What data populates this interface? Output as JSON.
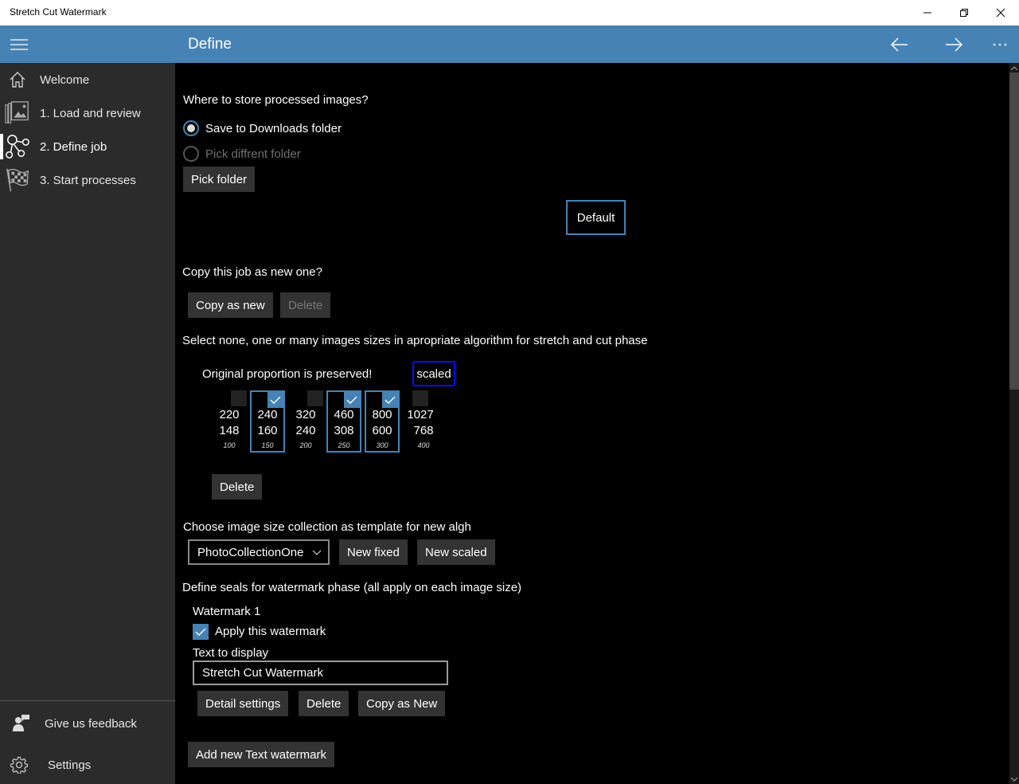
{
  "window": {
    "title": "Stretch Cut Watermark",
    "controls": [
      "minimize",
      "restore",
      "close"
    ]
  },
  "header": {
    "title": "Define",
    "back_icon": "arrow-left-icon",
    "forward_icon": "arrow-right-icon",
    "more_icon": "more-icon",
    "accent_color": "#4682b4"
  },
  "sidebar": {
    "items": [
      {
        "label": "Welcome",
        "icon": "home-icon"
      },
      {
        "label": "1. Load and review",
        "icon": "photos-icon"
      },
      {
        "label": "2. Define job",
        "icon": "nodes-icon",
        "active": true
      },
      {
        "label": "3. Start processes",
        "icon": "checkered-flag-icon"
      }
    ],
    "footer": [
      {
        "label": "Give us feedback",
        "icon": "feedback-icon"
      },
      {
        "label": "Settings",
        "icon": "gear-icon"
      }
    ]
  },
  "storage": {
    "question": "Where to store processed images?",
    "options": [
      {
        "label": "Save to Downloads folder",
        "selected": true,
        "enabled": true
      },
      {
        "label": "Pick diffrent folder",
        "selected": false,
        "enabled": false
      }
    ],
    "pick_folder_label": "Pick folder",
    "default_label": "Default"
  },
  "copy_job": {
    "question": "Copy this job as new one?",
    "copy_label": "Copy as new",
    "delete_label": "Delete"
  },
  "sizes": {
    "instruction": "Select none, one or many images sizes in apropriate algorithm for stretch and cut phase",
    "note": "Original proportion is preserved!",
    "mode_label": "scaled",
    "items": [
      {
        "width": "220",
        "height": "148",
        "num": "100",
        "checked": false
      },
      {
        "width": "240",
        "height": "160",
        "num": "150",
        "checked": true
      },
      {
        "width": "320",
        "height": "240",
        "num": "200",
        "checked": false
      },
      {
        "width": "460",
        "height": "308",
        "num": "250",
        "checked": true
      },
      {
        "width": "800",
        "height": "600",
        "num": "300",
        "checked": true
      },
      {
        "width": "1027",
        "height": "768",
        "num": "400",
        "checked": false
      }
    ],
    "delete_label": "Delete"
  },
  "template": {
    "label": "Choose image size collection as template for new algh",
    "selected_collection": "PhotoCollectionOne",
    "new_fixed_label": "New fixed",
    "new_scaled_label": "New scaled"
  },
  "watermarks": {
    "label": "Define seals for watermark phase (all apply on each image size)",
    "items": [
      {
        "title": "Watermark 1",
        "apply_label": "Apply this watermark",
        "apply_checked": true,
        "text_label": "Text to display",
        "text_value": "Stretch Cut Watermark",
        "detail_label": "Detail settings",
        "delete_label": "Delete",
        "copy_label": "Copy as New"
      }
    ],
    "add_label": "Add new Text watermark"
  }
}
